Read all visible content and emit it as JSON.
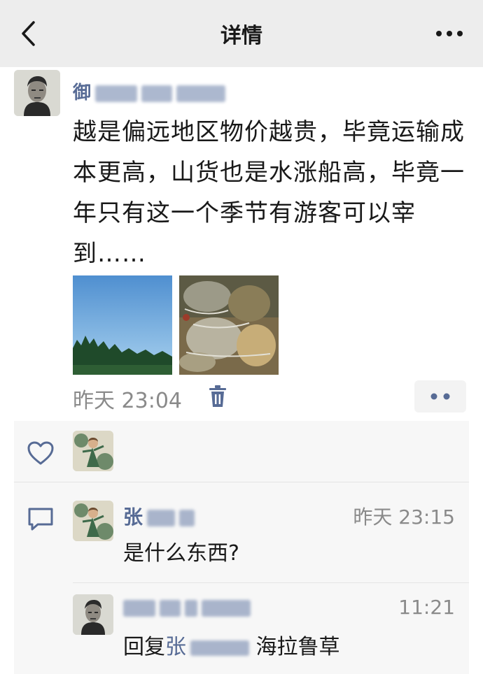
{
  "header": {
    "title": "详情",
    "back_icon": "chevron-left-icon",
    "more_icon": "more-dots-icon"
  },
  "post": {
    "author_visible": "御",
    "text": "越是偏远地区物价越贵，毕竟运输成本更高，山货也是水涨船高，毕竟一年只有这一个季节有游客可以宰到……",
    "time": "昨天 23:04",
    "delete_icon": "trash-icon",
    "menu_icon": "dots-menu-icon"
  },
  "likes": {
    "icon": "heart-icon"
  },
  "comments": [
    {
      "author_visible": "张",
      "time": "昨天 23:15",
      "text": "是什么东西?"
    },
    {
      "author_visible": "",
      "time": "11:21",
      "reply_keyword": "回复",
      "reply_to_visible": "张",
      "text": "海拉鲁草"
    }
  ],
  "colors": {
    "link": "#576b95",
    "background_social": "#f7f7f7",
    "header_bg": "#ededed",
    "time_gray": "#8a8a8a"
  }
}
